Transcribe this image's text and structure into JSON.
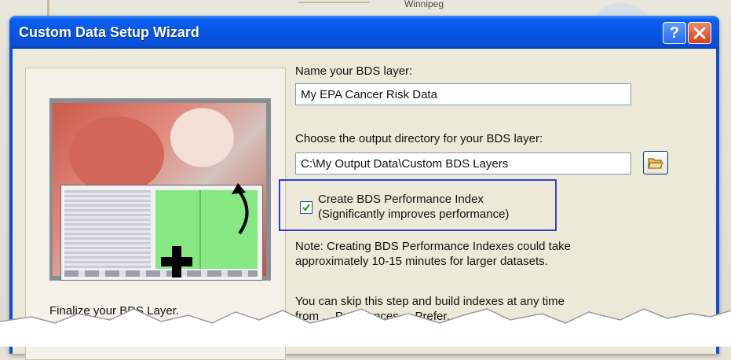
{
  "background": {
    "map_label": "Winnipeg"
  },
  "window": {
    "title": "Custom Data Setup Wizard",
    "help_label": "?"
  },
  "left_panel": {
    "caption": "Finalize your BDS Layer."
  },
  "form": {
    "layer_name_label": "Name your BDS layer:",
    "layer_name_value": "My EPA Cancer Risk Data",
    "output_dir_label": "Choose the output directory for your BDS layer:",
    "output_dir_value": "C:\\My Output Data\\Custom BDS Layers",
    "perf_index_checkbox": {
      "checked": true,
      "label_line1": "Create BDS Performance Index",
      "label_line2": "(Significantly improves performance)"
    },
    "note_line1": "Note: Creating BDS Performance Indexes could take",
    "note_line2": "approximately 10-15 minutes for larger datasets.",
    "skip_line1": "You can skip this step and build indexes at any time",
    "skip_line2": "from ... Preferences ... Prefer..."
  },
  "icons": {
    "help": "question-mark-icon",
    "close": "close-x-icon",
    "browse": "open-folder-icon",
    "plus": "plus-icon",
    "arrow": "curved-arrow-icon",
    "check": "checkmark-icon"
  },
  "colors": {
    "titlebar": "#0a4fd6",
    "close_button": "#d4401a",
    "highlight_border": "#2f3fd6",
    "dialog_face": "#ece9d8"
  }
}
